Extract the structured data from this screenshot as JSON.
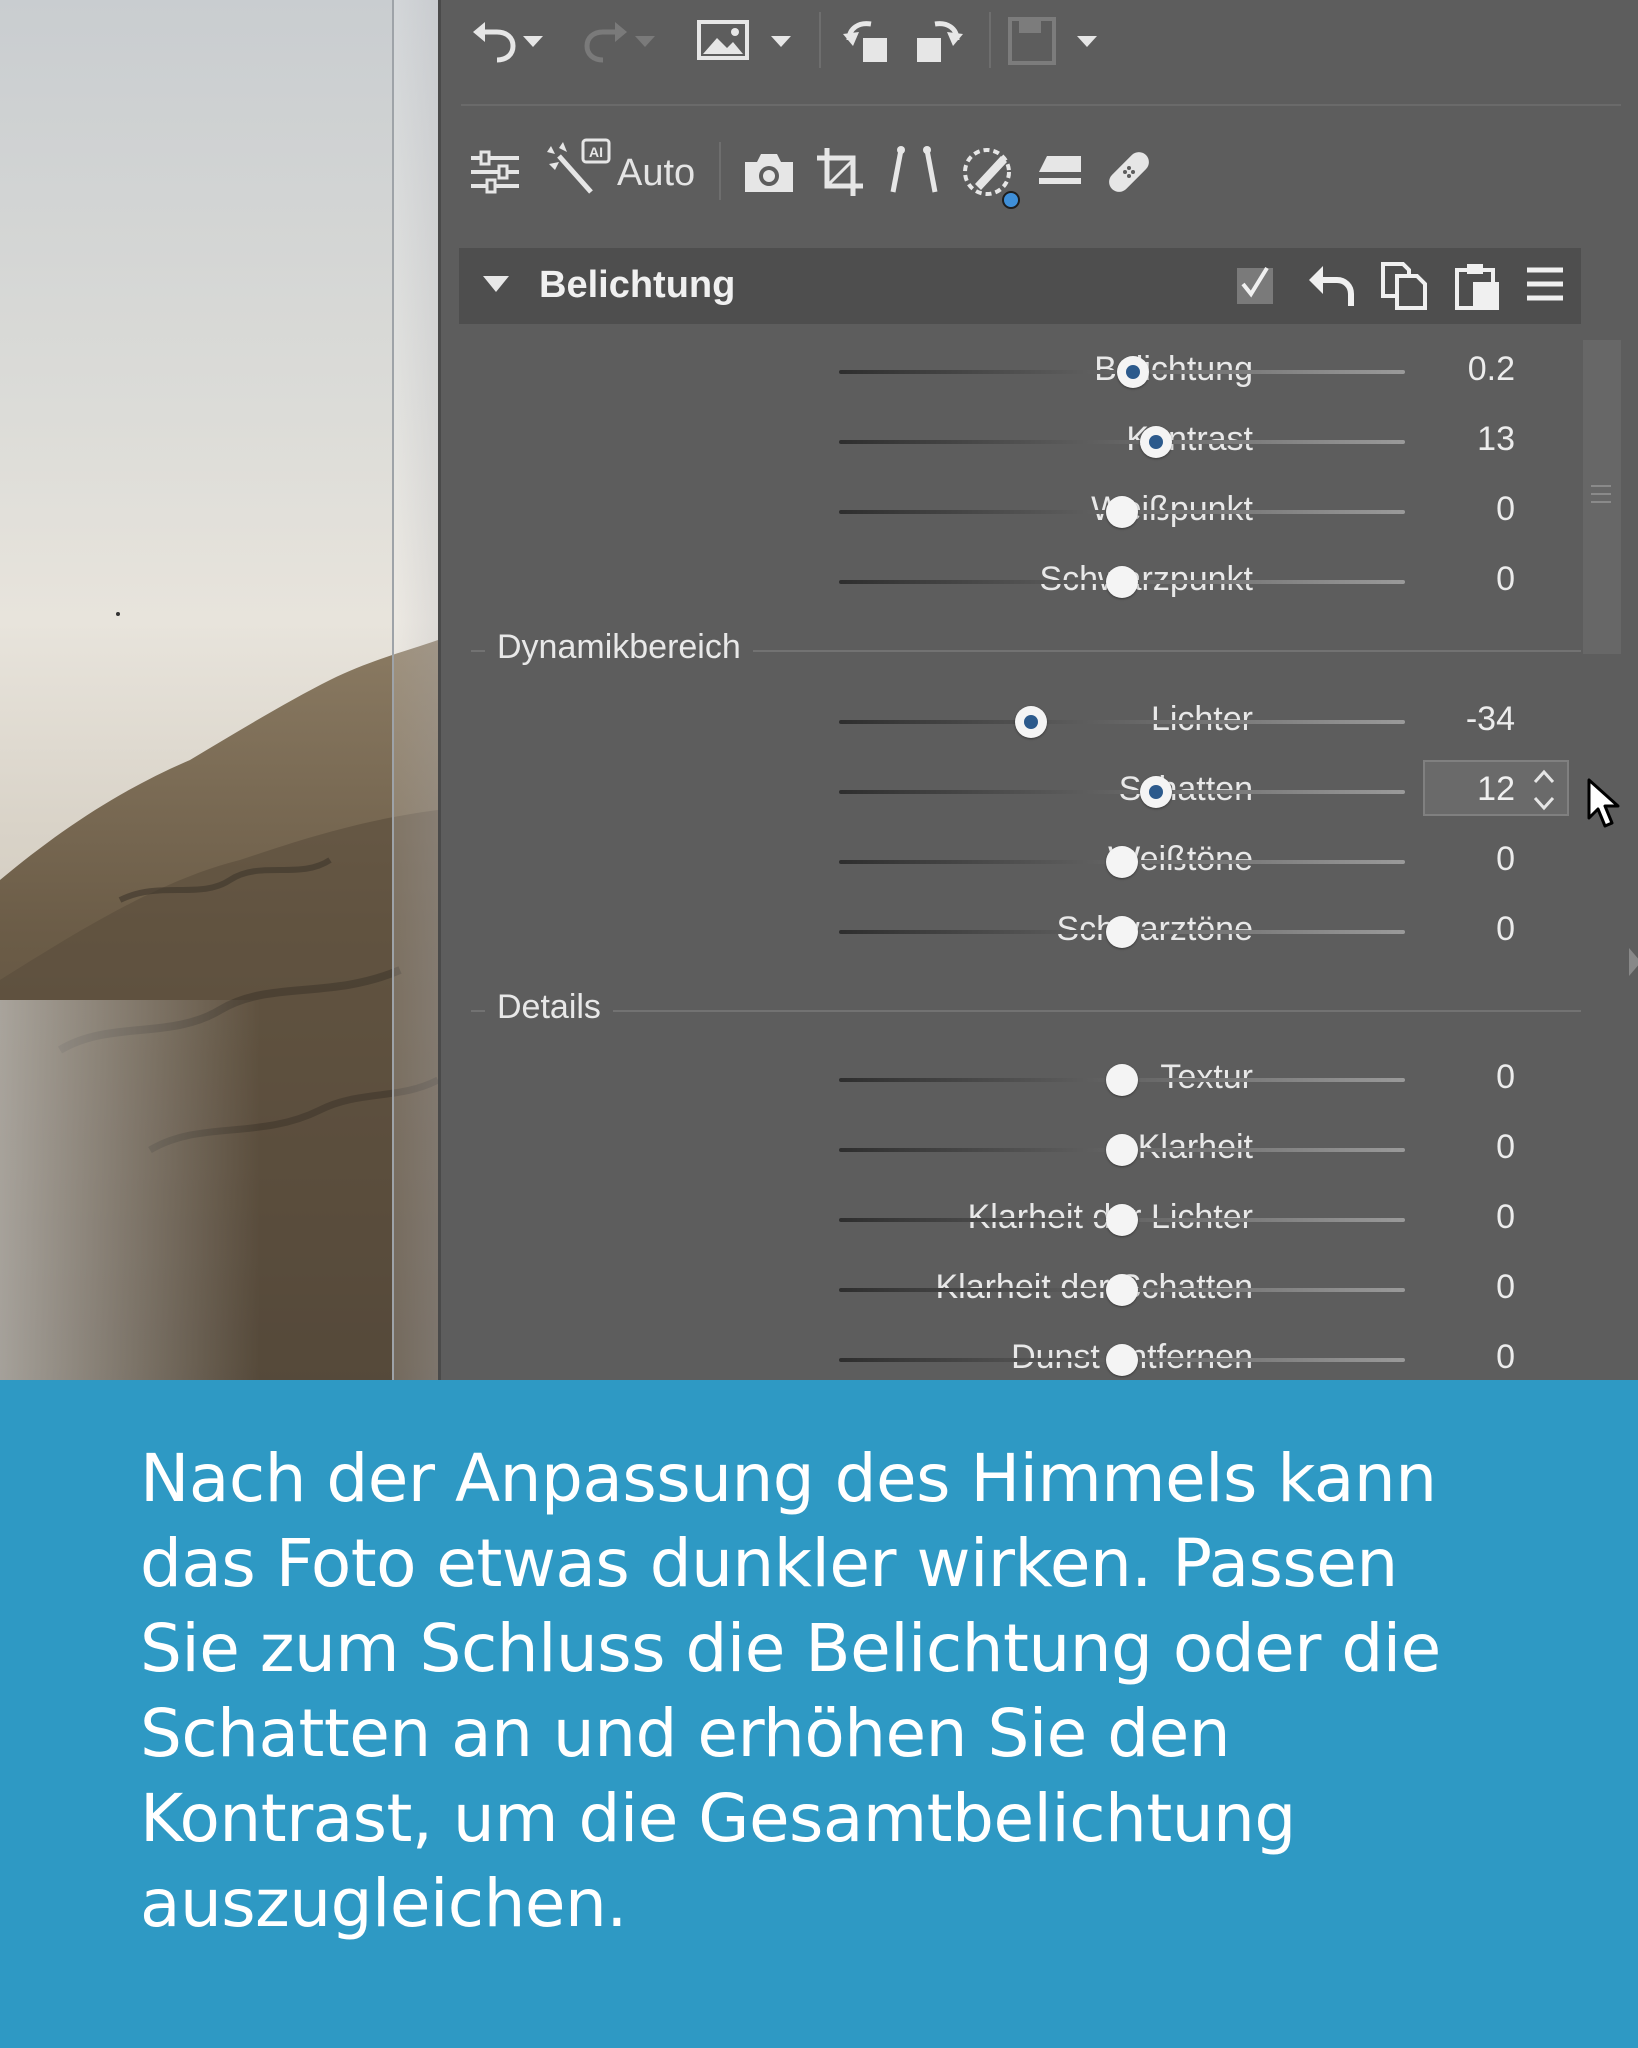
{
  "toolbar": {
    "auto_label": "Auto",
    "ai_badge": "AI"
  },
  "section": {
    "title": "Belichtung"
  },
  "rows": [
    {
      "label": "Belichtung",
      "value": "0.2",
      "position": 0.52,
      "modified": true
    },
    {
      "label": "Kontrast",
      "value": "13",
      "position": 0.56,
      "modified": true
    },
    {
      "label": "Weißpunkt",
      "value": "0",
      "position": 0.5,
      "modified": false
    },
    {
      "label": "Schwarzpunkt",
      "value": "0",
      "position": 0.5,
      "modified": false
    }
  ],
  "groups": {
    "dynamic": "Dynamikbereich",
    "details": "Details"
  },
  "dynamic_rows": [
    {
      "label": "Lichter",
      "value": "-34",
      "position": 0.34,
      "modified": true
    },
    {
      "label": "Schatten",
      "value": "12",
      "position": 0.56,
      "modified": true,
      "editing": true
    },
    {
      "label": "Weißtöne",
      "value": "0",
      "position": 0.5,
      "modified": false
    },
    {
      "label": "Schwarztöne",
      "value": "0",
      "position": 0.5,
      "modified": false
    }
  ],
  "detail_rows": [
    {
      "label": "Textur",
      "value": "0",
      "position": 0.5,
      "modified": false
    },
    {
      "label": "Klarheit",
      "value": "0",
      "position": 0.5,
      "modified": false
    },
    {
      "label": "Klarheit der Lichter",
      "value": "0",
      "position": 0.5,
      "modified": false
    },
    {
      "label": "Klarheit der Schatten",
      "value": "0",
      "position": 0.5,
      "modified": false
    },
    {
      "label": "Dunst entfernen",
      "value": "0",
      "position": 0.5,
      "modified": false
    }
  ],
  "caption": {
    "lines": [
      "Nach der Anpassung des Himmels kann",
      "das Foto etwas dunkler wirken. Passen",
      "Sie zum Schluss die Belichtung oder die",
      "Schatten an und erhöhen Sie den",
      "Kontrast, um die Gesamtbelichtung",
      "auszugleichen."
    ]
  },
  "colors": {
    "caption_bg": "#2e99c4",
    "panel_bg": "#5d5d5d",
    "header_bg": "#4e4e4e",
    "thumb_modified": "#2c5a8c",
    "mask_dot": "#3f8fd8"
  },
  "icons": [
    "undo-icon",
    "redo-icon",
    "image-icon",
    "rotate-left-icon",
    "rotate-right-icon",
    "save-icon",
    "sliders-icon",
    "magic-wand-icon",
    "camera-icon",
    "crop-icon",
    "perspective-icon",
    "mask-brush-icon",
    "eraser-icon",
    "healing-bandage-icon",
    "checkbox-icon",
    "reset-icon",
    "copy-icon",
    "paste-icon",
    "menu-icon"
  ]
}
